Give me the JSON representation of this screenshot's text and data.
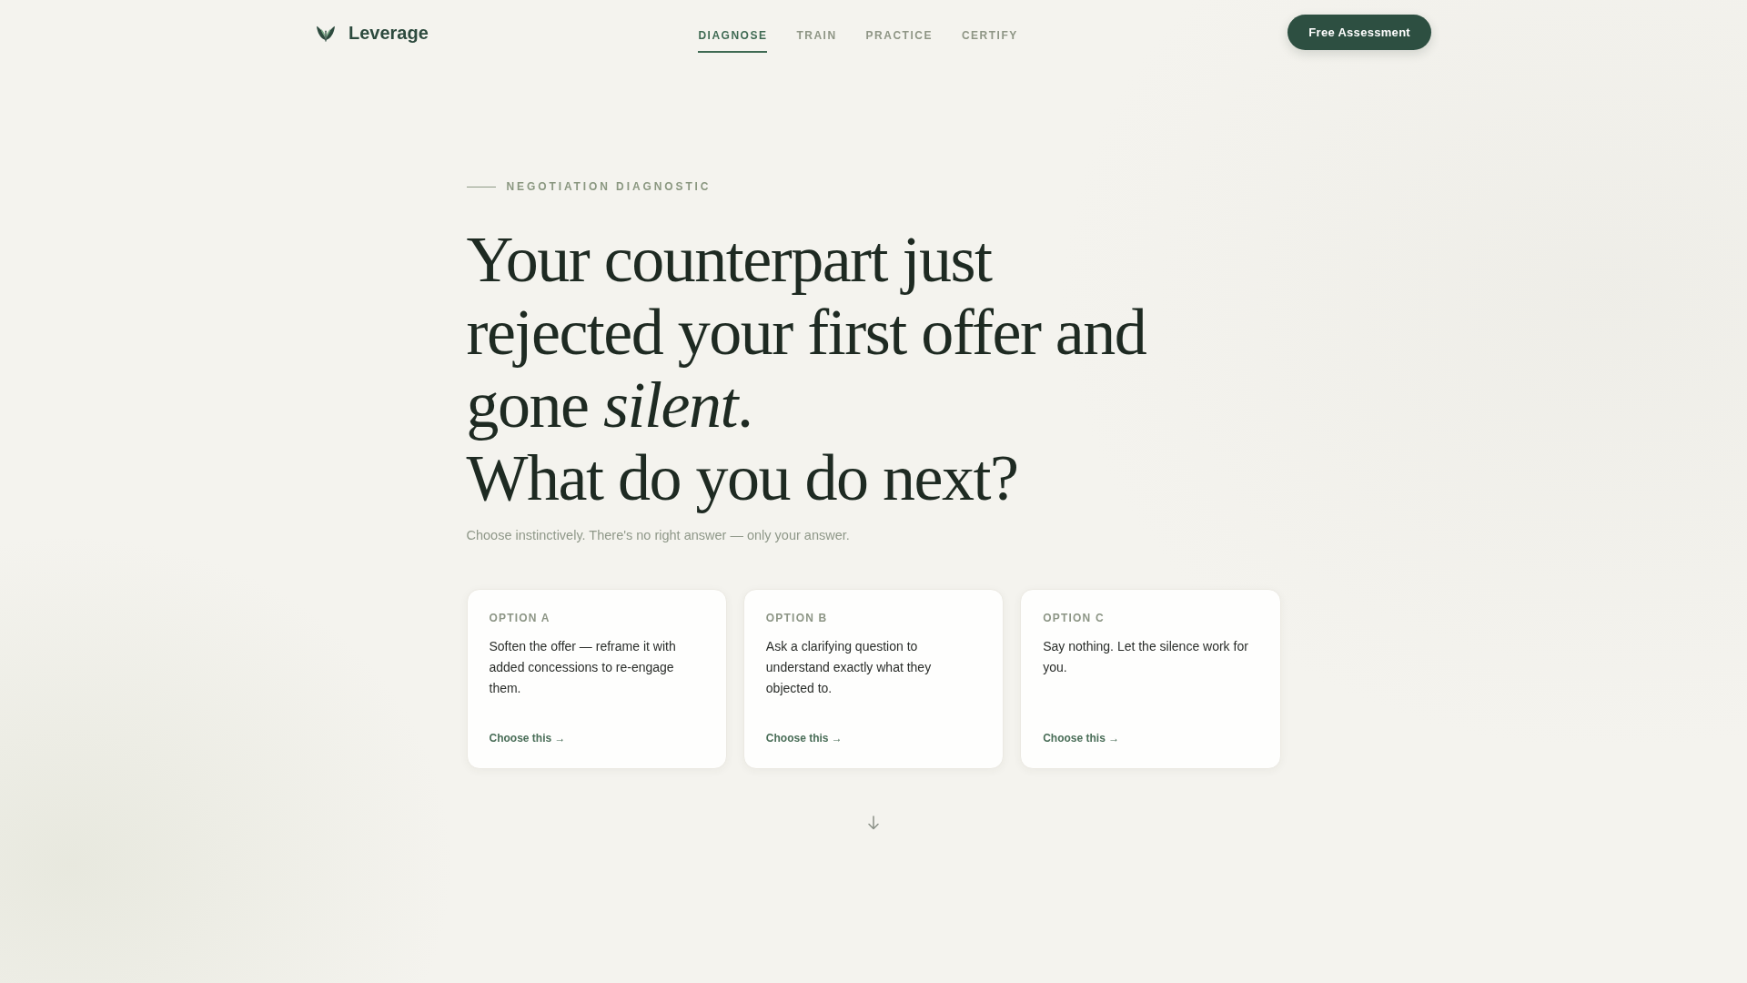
{
  "header": {
    "brand": "Leverage",
    "nav": [
      {
        "label": "DIAGNOSE",
        "selected": true
      },
      {
        "label": "TRAIN",
        "selected": false
      },
      {
        "label": "PRACTICE",
        "selected": false
      },
      {
        "label": "CERTIFY",
        "selected": false
      }
    ],
    "cta": "Free Assessment"
  },
  "hero": {
    "eyebrow": "NEGOTIATION DIAGNOSTIC",
    "headline": [
      "Your counterpart just rejected your first offer and gone *silent*.",
      "What do you do next?"
    ],
    "subtitle": "Choose instinctively. There's no right answer — only your answer.",
    "options": [
      {
        "label": "OPTION A",
        "text": "Soften the offer — reframe it with added concessions to re-engage them.",
        "action": "Choose this →"
      },
      {
        "label": "OPTION B",
        "text": "Ask a clarifying question to understand exactly what they objected to.",
        "action": "Choose this →"
      },
      {
        "label": "OPTION C",
        "text": "Say nothing. Let the silence work for you.",
        "action": "Choose this →"
      }
    ]
  }
}
